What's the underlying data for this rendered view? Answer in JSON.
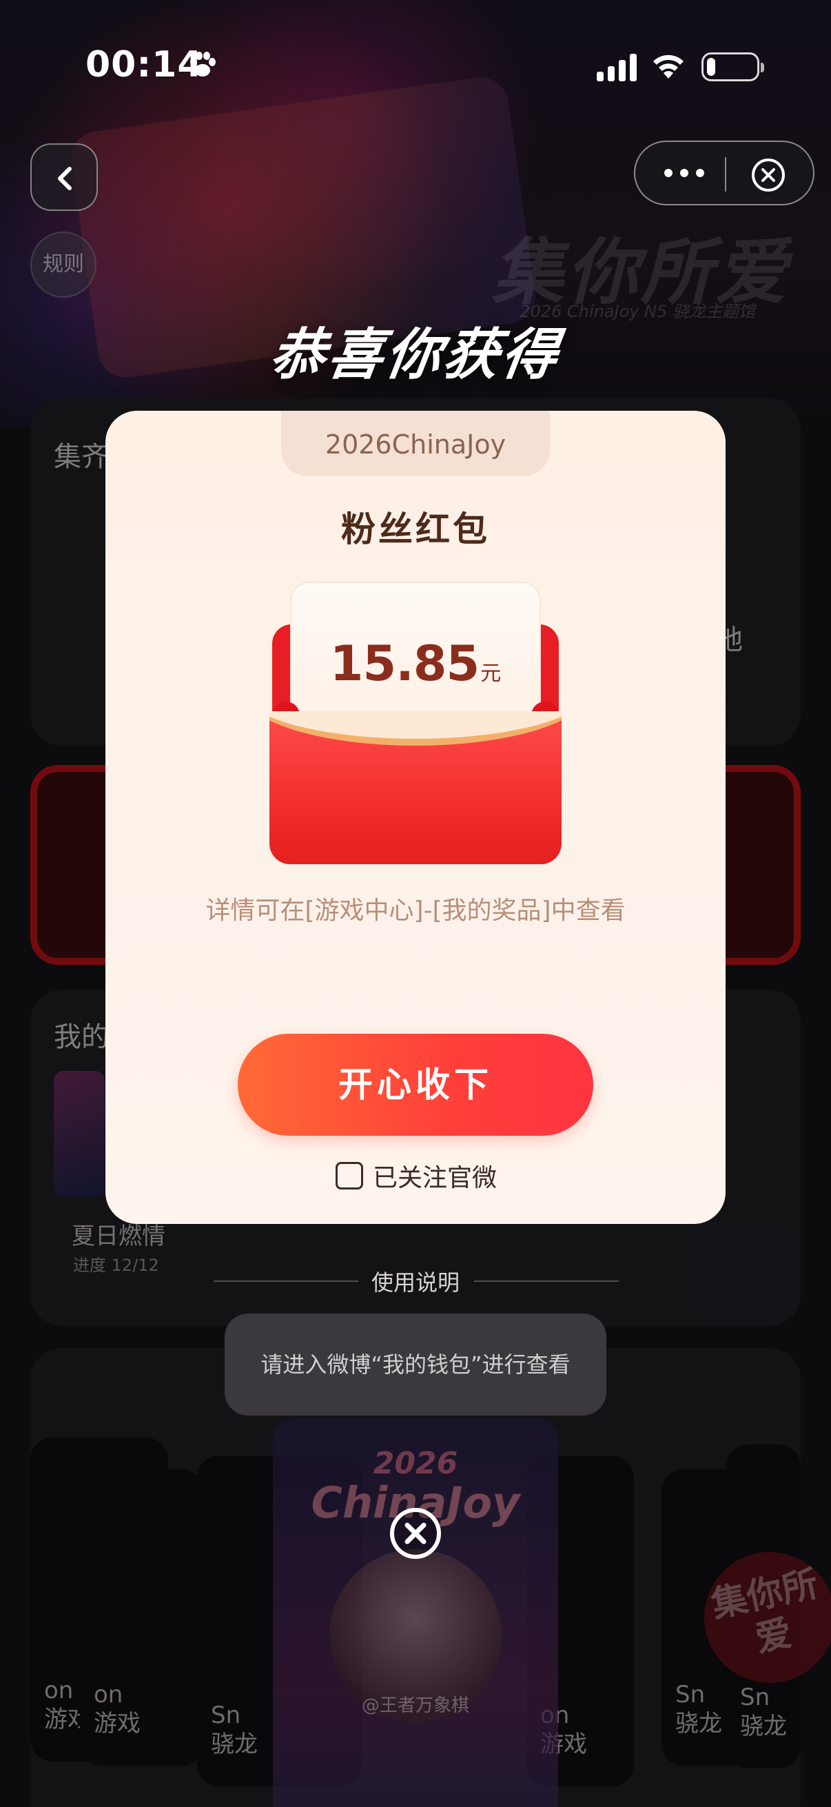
{
  "status_bar": {
    "time": "00:14"
  },
  "nav": {
    "rules_label": "规则"
  },
  "background": {
    "hero_title": "集你所爱",
    "hero_subtitle": "2026 ChinaJoy N5 骁龙主题馆",
    "section1_title": "集齐",
    "section1_right_fragment": "地",
    "section2_title": "我的",
    "card_name": "夏日燃情",
    "card_progress": "进度 12/12",
    "mini_cards": [
      {
        "line1": "on",
        "line2": "游戏"
      },
      {
        "line1": "on",
        "line2": "游戏"
      },
      {
        "line1": "Sn",
        "line2": "骁龙"
      },
      {
        "line1": "on",
        "line2": "游戏"
      },
      {
        "line1": "Sn",
        "line2": "骁龙"
      },
      {
        "line1": "Sn",
        "line2": "骁龙"
      }
    ],
    "stamp": "集你所爱"
  },
  "congrats_title": "恭喜你获得",
  "modal": {
    "tag": "2026ChinaJoy",
    "prize_name": "粉丝红包",
    "amount": "15.85",
    "unit": "元",
    "hint": "详情可在[游戏中心]-[我的奖品]中查看",
    "accept_label": "开心收下",
    "follow_label": "已关注官微",
    "follow_checked": false
  },
  "usage_label": "使用说明",
  "toast": "请进入微博“我的钱包”进行查看",
  "poster": {
    "year": "2026",
    "brand": "ChinaJoy",
    "handle": "@王者万象棋"
  },
  "colors": {
    "accent": "#ff4a3a",
    "modal_bg": "#fff0e6",
    "amount_text": "#8b2d1c"
  }
}
